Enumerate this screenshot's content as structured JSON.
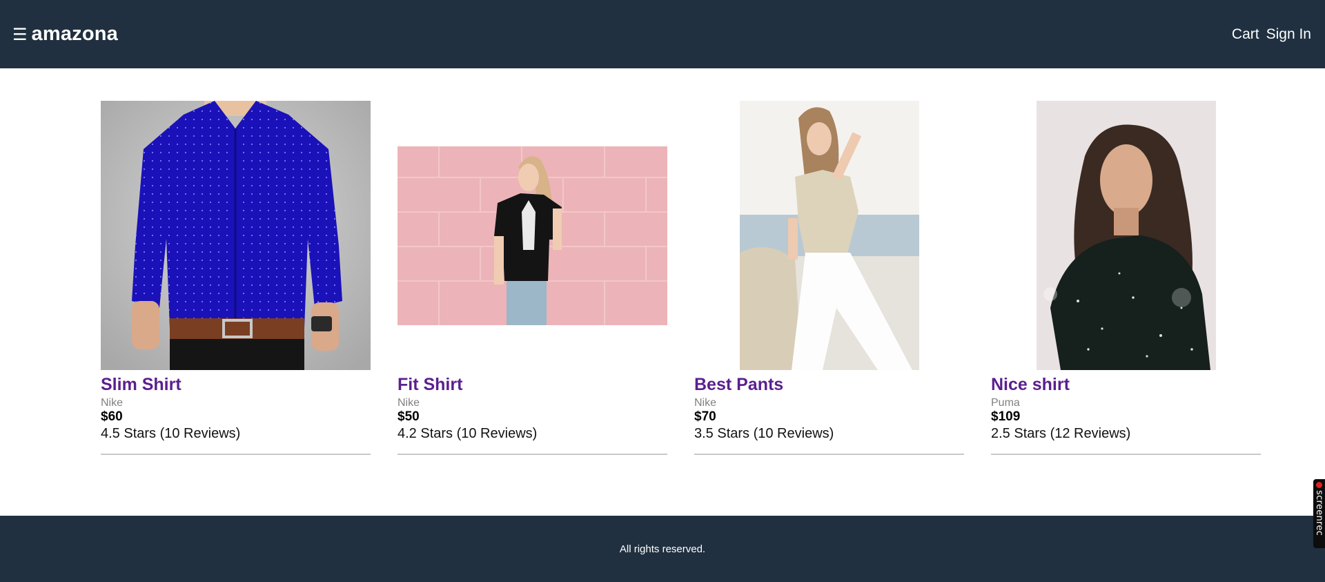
{
  "header": {
    "menu_icon": "☰",
    "logo": "amazona",
    "cart_label": "Cart",
    "signin_label": "Sign In",
    "background": "#203040"
  },
  "products": [
    {
      "name": "Slim Shirt",
      "brand": "Nike",
      "price": "$60",
      "rating": "4.5 Stars (10 Reviews)",
      "image": "blue-shirt-photo"
    },
    {
      "name": "Fit Shirt",
      "brand": "Nike",
      "price": "$50",
      "rating": "4.2 Stars (10 Reviews)",
      "image": "woman-black-tshirt-photo"
    },
    {
      "name": "Best Pants",
      "brand": "Nike",
      "price": "$70",
      "rating": "3.5 Stars (10 Reviews)",
      "image": "woman-white-pants-photo"
    },
    {
      "name": "Nice shirt",
      "brand": "Puma",
      "price": "$109",
      "rating": "2.5 Stars (12 Reviews)",
      "image": "woman-dark-sweater-photo"
    }
  ],
  "footer": {
    "text": "All rights reserved."
  },
  "recorder": {
    "label": "screenrec"
  },
  "colors": {
    "accent": "#5b1f8f",
    "dark": "#203040"
  }
}
